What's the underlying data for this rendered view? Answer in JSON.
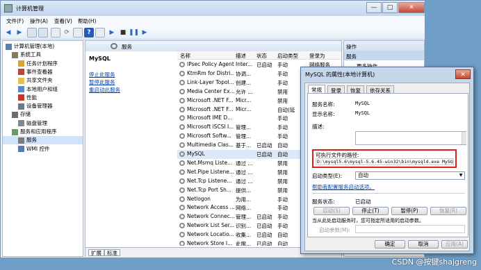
{
  "window": {
    "title": "计算机管理",
    "minimize": "—",
    "maximize": "□",
    "close": "✕"
  },
  "menu": [
    "文件(F)",
    "操作(A)",
    "查看(V)",
    "帮助(H)"
  ],
  "tree": [
    {
      "label": "计算机管理(本地)",
      "icon": "computer-icon",
      "indent": 0
    },
    {
      "label": "系统工具",
      "icon": "tools-icon",
      "indent": 1
    },
    {
      "label": "任务计划程序",
      "icon": "clock-icon",
      "indent": 2
    },
    {
      "label": "事件查看器",
      "icon": "event-icon",
      "indent": 2
    },
    {
      "label": "共享文件夹",
      "icon": "folder-icon",
      "indent": 2
    },
    {
      "label": "本地用户和组",
      "icon": "users-icon",
      "indent": 2
    },
    {
      "label": "性能",
      "icon": "performance-icon",
      "indent": 2
    },
    {
      "label": "设备管理器",
      "icon": "device-icon",
      "indent": 2
    },
    {
      "label": "存储",
      "icon": "storage-icon",
      "indent": 1
    },
    {
      "label": "磁盘管理",
      "icon": "disk-icon",
      "indent": 2
    },
    {
      "label": "服务和应用程序",
      "icon": "apps-icon",
      "indent": 1
    },
    {
      "label": "服务",
      "icon": "services-icon",
      "indent": 2
    },
    {
      "label": "WMI 控件",
      "icon": "wmi-icon",
      "indent": 2
    }
  ],
  "services_panel": {
    "header": "服务",
    "selected_name": "MySQL",
    "links": [
      "停止此服务",
      "暂停此服务",
      "重启动此服务"
    ],
    "columns": [
      "名称",
      "描述",
      "状态",
      "启动类型",
      "登录为"
    ],
    "rows": [
      [
        "IPsec Policy Agent",
        "Inter...",
        "已启动",
        "手动",
        "网络服务"
      ],
      [
        "KtmRm for Distri...",
        "协调...",
        "",
        "手动",
        ""
      ],
      [
        "Link-Layer Topol...",
        "创建...",
        "",
        "手动",
        ""
      ],
      [
        "Media Center Ex...",
        "允许 ...",
        "",
        "禁用",
        ""
      ],
      [
        "Microsoft .NET F...",
        "Micr...",
        "",
        "禁用",
        ""
      ],
      [
        "Microsoft .NET F...",
        "Micr...",
        "",
        "自动(延",
        ""
      ],
      [
        "Microsoft IME D...",
        "",
        "",
        "手动",
        ""
      ],
      [
        "Microsoft iSCSI I...",
        "管理...",
        "",
        "手动",
        ""
      ],
      [
        "Microsoft Softw...",
        "管理...",
        "",
        "手动",
        ""
      ],
      [
        "Multimedia Clas...",
        "基于...",
        "已启动",
        "自动",
        ""
      ],
      [
        "MySQL",
        "",
        "已启动",
        "自动",
        ""
      ],
      [
        "Net.Msmq Liste...",
        "通过 ...",
        "",
        "禁用",
        ""
      ],
      [
        "Net.Pipe Listene...",
        "通过 ...",
        "",
        "禁用",
        ""
      ],
      [
        "Net.Tcp Listene...",
        "通过 ...",
        "",
        "禁用",
        ""
      ],
      [
        "Net.Tcp Port Sh...",
        "提供...",
        "",
        "禁用",
        ""
      ],
      [
        "Netlogon",
        "为用...",
        "",
        "手动",
        ""
      ],
      [
        "Network Access ...",
        "网络...",
        "",
        "手动",
        ""
      ],
      [
        "Network Connec...",
        "管理...",
        "已启动",
        "手动",
        ""
      ],
      [
        "Network List Ser...",
        "识别...",
        "已启动",
        "手动",
        ""
      ],
      [
        "Network Locatio...",
        "收集...",
        "已启动",
        "自动",
        ""
      ],
      [
        "Network Store I...",
        "此服...",
        "已启动",
        "自动",
        ""
      ]
    ],
    "bottom_tabs": [
      "扩展",
      "标准"
    ]
  },
  "actions": {
    "title": "操作",
    "section": "服务",
    "more": "更多操作"
  },
  "dialog": {
    "title": "MySQL 的属性(本地计算机)",
    "close": "✕",
    "tabs": [
      "常规",
      "登录",
      "恢复",
      "依存关系"
    ],
    "service_name_label": "服务名称:",
    "service_name": "MySQL",
    "display_name_label": "显示名称:",
    "display_name": "MySQL",
    "description_label": "描述:",
    "path_label": "可执行文件的路径:",
    "path_value": "D:\\mysql5.6\\mysql-5.6.45-win32\\bin\\mysqld.exe MySQL",
    "startup_label": "启动类型(E):",
    "startup_value": "自动",
    "help_link": "帮助我配置服务启动选项。",
    "status_label": "服务状态:",
    "status_value": "已启动",
    "buttons": [
      "启动(S)",
      "停止(T)",
      "暂停(P)",
      "恢复(R)"
    ],
    "hint": "当从此处启动服务时，您可指定所适用的启动参数。",
    "params_label": "启动参数(M):",
    "ok": "确定",
    "cancel": "取消",
    "apply": "应用(A)"
  },
  "watermark": "CSDN @按键shajgreng",
  "colors": {
    "highlight_border": "#e21b1b",
    "link": "#0645ad"
  }
}
